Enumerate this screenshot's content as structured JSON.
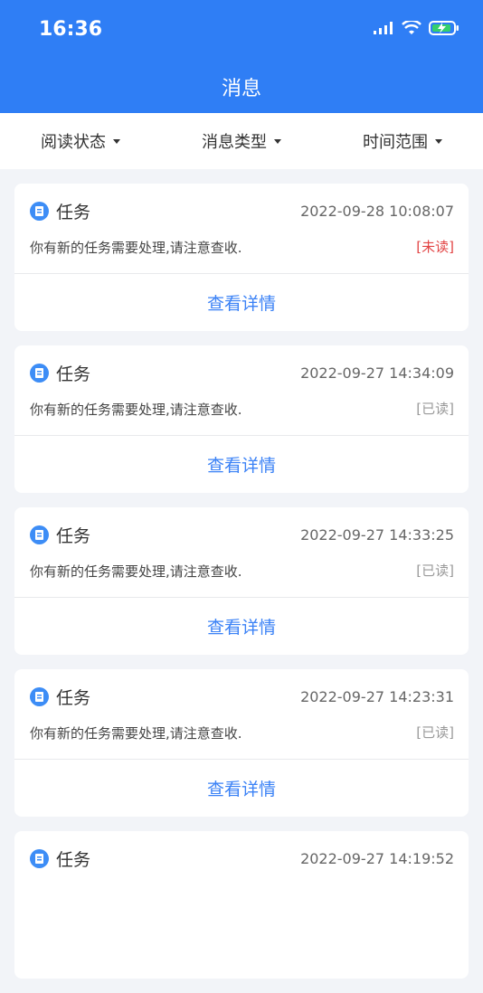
{
  "status_bar": {
    "time": "16:36"
  },
  "header": {
    "title": "消息"
  },
  "filters": [
    {
      "label": "阅读状态"
    },
    {
      "label": "消息类型"
    },
    {
      "label": "时间范围"
    }
  ],
  "messages": [
    {
      "title": "任务",
      "time": "2022-09-28 10:08:07",
      "text": "你有新的任务需要处理,请注意查收.",
      "status": "[未读]",
      "unread": true,
      "action": "查看详情"
    },
    {
      "title": "任务",
      "time": "2022-09-27 14:34:09",
      "text": "你有新的任务需要处理,请注意查收.",
      "status": "[已读]",
      "unread": false,
      "action": "查看详情"
    },
    {
      "title": "任务",
      "time": "2022-09-27 14:33:25",
      "text": "你有新的任务需要处理,请注意查收.",
      "status": "[已读]",
      "unread": false,
      "action": "查看详情"
    },
    {
      "title": "任务",
      "time": "2022-09-27 14:23:31",
      "text": "你有新的任务需要处理,请注意查收.",
      "status": "[已读]",
      "unread": false,
      "action": "查看详情"
    },
    {
      "title": "任务",
      "time": "2022-09-27 14:19:52",
      "text": "",
      "status": "",
      "unread": false,
      "action": ""
    }
  ],
  "colors": {
    "primary": "#2f7ef5",
    "unread": "#e24444",
    "read": "#999999",
    "link": "#3b82f6"
  }
}
